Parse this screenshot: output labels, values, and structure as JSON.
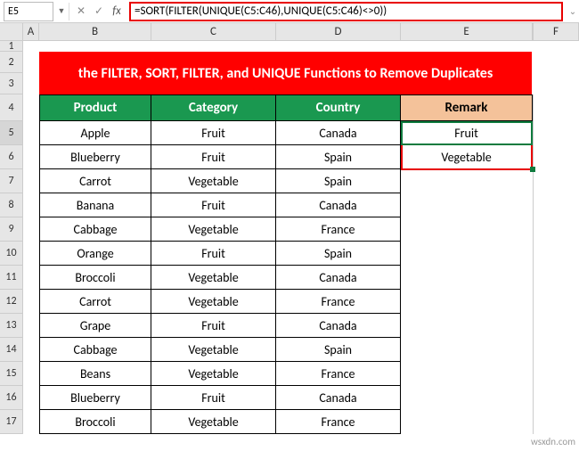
{
  "nameBox": {
    "value": "E5"
  },
  "formulaBar": {
    "formula": "=SORT(FILTER(UNIQUE(C5:C46),UNIQUE(C5:C46)<>0))"
  },
  "columns": {
    "A": "A",
    "B": "B",
    "C": "C",
    "D": "D",
    "E": "E",
    "F": "F"
  },
  "rowNumbers": [
    "1",
    "2",
    "3",
    "4",
    "5",
    "6",
    "7",
    "8",
    "9",
    "10",
    "11",
    "12",
    "13",
    "14",
    "15",
    "16",
    "17"
  ],
  "banner": "the FILTER, SORT, FILTER, and UNIQUE Functions to Remove Duplicates",
  "headers": {
    "product": "Product",
    "category": "Category",
    "country": "Country",
    "remark": "Remark"
  },
  "remarks": [
    "Fruit",
    "Vegetable"
  ],
  "table": [
    {
      "product": "Apple",
      "category": "Fruit",
      "country": "Canada"
    },
    {
      "product": "Blueberry",
      "category": "Fruit",
      "country": "Spain"
    },
    {
      "product": "Carrot",
      "category": "Vegetable",
      "country": "Spain"
    },
    {
      "product": "Banana",
      "category": "Fruit",
      "country": "Canada"
    },
    {
      "product": "Cabbage",
      "category": "Vegetable",
      "country": "France"
    },
    {
      "product": "Orange",
      "category": "Fruit",
      "country": "Spain"
    },
    {
      "product": "Broccoli",
      "category": "Vegetable",
      "country": "Canada"
    },
    {
      "product": "Carrot",
      "category": "Vegetable",
      "country": "France"
    },
    {
      "product": "Grape",
      "category": "Fruit",
      "country": "Canada"
    },
    {
      "product": "Cabbage",
      "category": "Vegetable",
      "country": "Spain"
    },
    {
      "product": "Beans",
      "category": "Vegetable",
      "country": "France"
    },
    {
      "product": "Blueberry",
      "category": "Fruit",
      "country": "Canada"
    },
    {
      "product": "Broccoli",
      "category": "Vegetable",
      "country": "France"
    }
  ],
  "watermark": "wsxdn.com"
}
